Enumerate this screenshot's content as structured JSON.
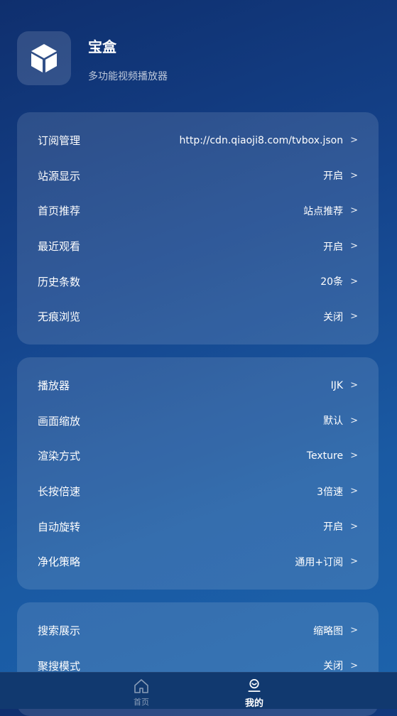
{
  "header": {
    "title": "宝盒",
    "subtitle": "多功能视频播放器",
    "icon": "cube-icon"
  },
  "cards": [
    {
      "rows": [
        {
          "label": "订阅管理",
          "value": "http://cdn.qiaoji8.com/tvbox.json",
          "chevron": ">"
        },
        {
          "label": "站源显示",
          "value": "开启",
          "chevron": ">"
        },
        {
          "label": "首页推荐",
          "value": "站点推荐",
          "chevron": ">"
        },
        {
          "label": "最近观看",
          "value": "开启",
          "chevron": ">"
        },
        {
          "label": "历史条数",
          "value": "20条",
          "chevron": ">"
        },
        {
          "label": "无痕浏览",
          "value": "关闭",
          "chevron": ">"
        }
      ]
    },
    {
      "rows": [
        {
          "label": "播放器",
          "value": "IJK",
          "chevron": ">"
        },
        {
          "label": "画面缩放",
          "value": "默认",
          "chevron": ">"
        },
        {
          "label": "渲染方式",
          "value": "Texture",
          "chevron": ">"
        },
        {
          "label": "长按倍速",
          "value": "3倍速",
          "chevron": ">"
        },
        {
          "label": "自动旋转",
          "value": "开启",
          "chevron": ">"
        },
        {
          "label": "净化策略",
          "value": "通用+订阅",
          "chevron": ">"
        }
      ]
    },
    {
      "rows": [
        {
          "label": "搜索展示",
          "value": "缩略图",
          "chevron": ">"
        },
        {
          "label": "聚搜模式",
          "value": "关闭",
          "chevron": ">"
        }
      ]
    }
  ],
  "nav": {
    "home_label": "首页",
    "mine_label": "我的",
    "home_icon": "home-icon",
    "mine_icon": "user-icon"
  },
  "colors": {
    "bg_top": "#0f2f6e",
    "bg_bottom": "#1c63ac",
    "nav_bg": "#11396f"
  }
}
